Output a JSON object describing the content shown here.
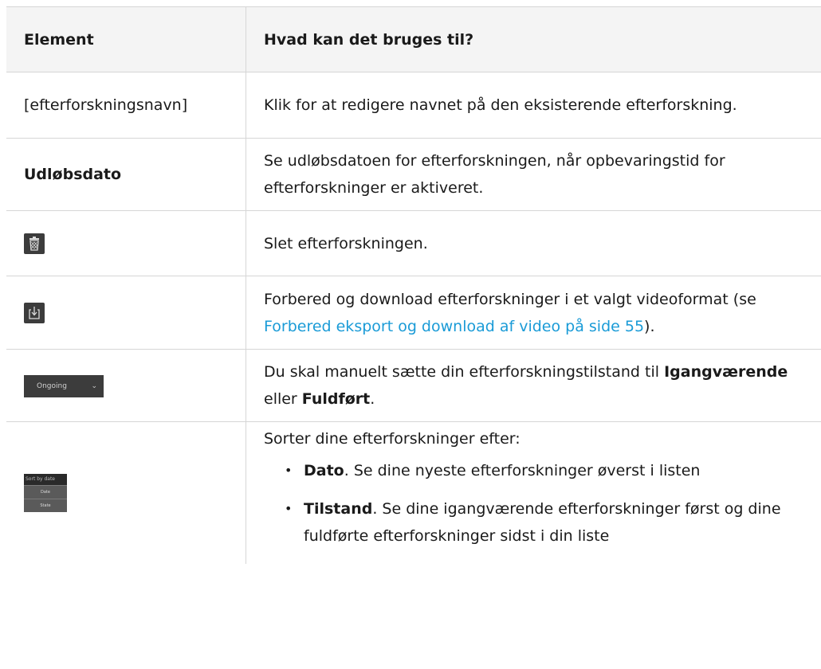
{
  "header": {
    "col_element": "Element",
    "col_usage": "Hvad kan det bruges til?"
  },
  "rows": [
    {
      "element": "[efterforskningsnavn]",
      "description": "Klik for at redigere navnet på den eksisterende efterforskning."
    },
    {
      "element": "Udløbsdato",
      "description": "Se udløbsdatoen for efterforskningen, når opbevaringstid for efterforskninger er aktiveret."
    },
    {
      "element_icon": "trash-icon",
      "description": "Slet efterforskningen."
    },
    {
      "element_icon": "download-icon",
      "description_before": "Forbered og download efterforskninger i et valgt videoformat (se ",
      "description_link": "Forbered eksport og download af video på side 55",
      "description_after": ")."
    },
    {
      "element_widget": {
        "label": "Ongoing",
        "icon": "chevron-down-icon"
      },
      "description_before": "Du skal manuelt sætte din efterforskningstilstand til ",
      "description_bold1": "Igangværende",
      "description_mid": " eller ",
      "description_bold2": "Fuldført",
      "description_after": "."
    },
    {
      "element_widget": {
        "title": "Sort by date",
        "options": [
          "Date",
          "State"
        ]
      },
      "description_intro": "Sorter dine efterforskninger efter:",
      "list": [
        {
          "term": "Dato",
          "text": ". Se dine nyeste efterforskninger øverst i listen"
        },
        {
          "term": "Tilstand",
          "text": ". Se dine igangværende efterforskninger først og dine fuldførte efterforskninger sidst i din liste"
        }
      ]
    }
  ],
  "colors": {
    "link": "#1a9bd7",
    "header_bg": "#f4f4f4",
    "icon_bg": "#3c3c3c",
    "border": "#d6d6d6"
  }
}
